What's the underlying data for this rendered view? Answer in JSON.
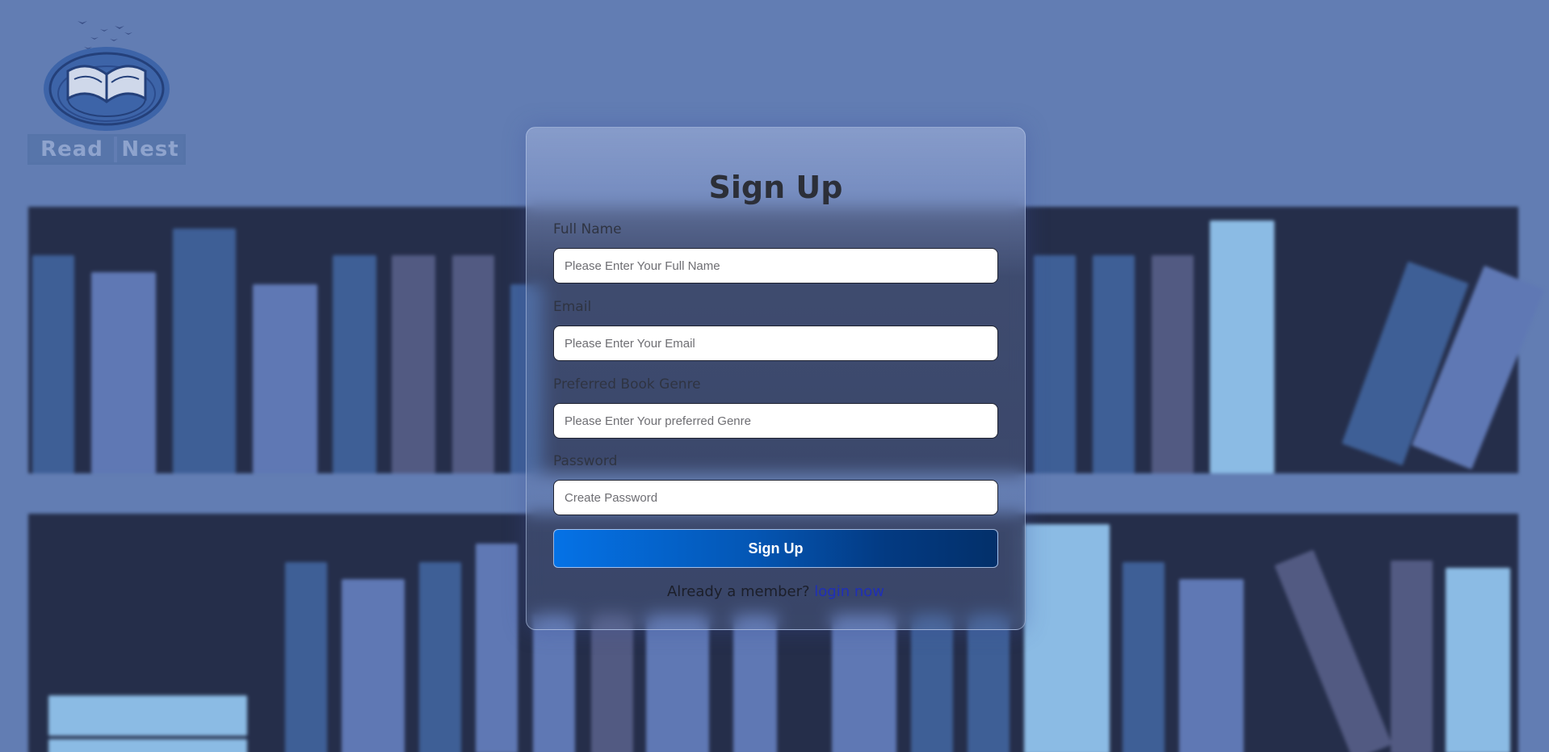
{
  "brand": {
    "logo_word_1": "Read",
    "logo_word_2": "Nest"
  },
  "signup": {
    "title": "Sign Up",
    "fields": [
      {
        "label": "Full Name",
        "placeholder": "Please Enter Your Full Name",
        "value": ""
      },
      {
        "label": "Email",
        "placeholder": "Please Enter Your Email",
        "value": ""
      },
      {
        "label": "Preferred Book Genre",
        "placeholder": "Please Enter Your preferred Genre",
        "value": ""
      },
      {
        "label": "Password",
        "placeholder": "Create Password",
        "value": ""
      }
    ],
    "submit_label": "Sign Up",
    "member_prompt": "Already a member?",
    "login_link": "login now"
  },
  "colors": {
    "background": "#627db3",
    "shelf": "#252e4a",
    "button_start": "#0572e6",
    "button_end": "#03306a",
    "link": "#1f2fb8"
  }
}
